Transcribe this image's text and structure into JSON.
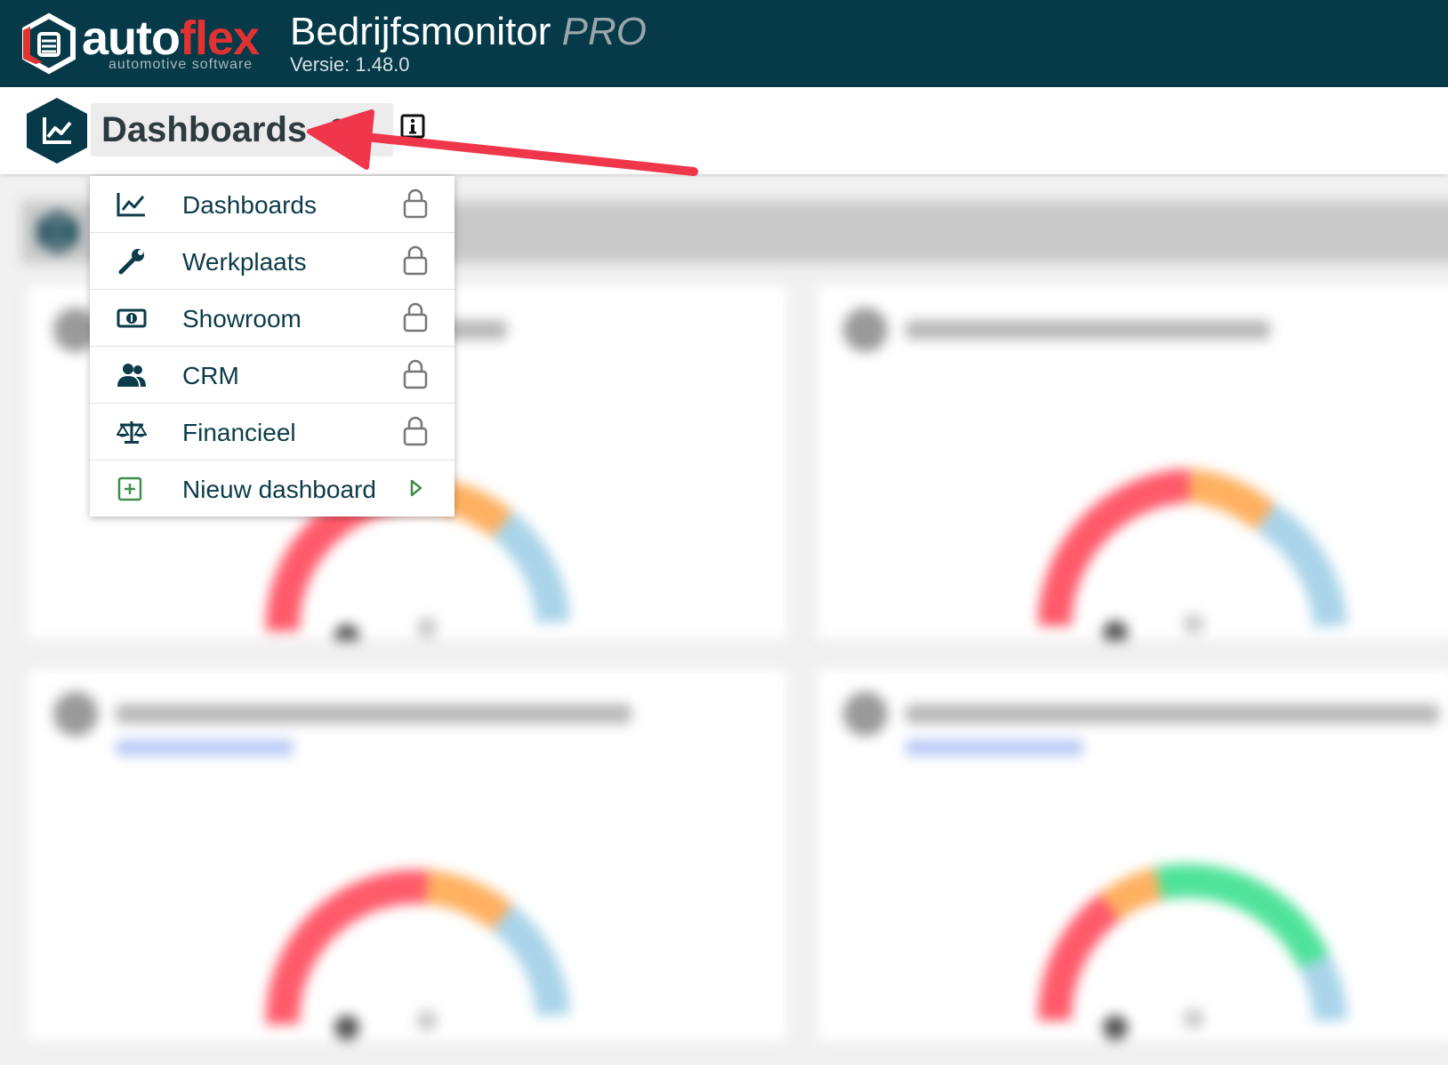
{
  "brand": {
    "logo_word_auto": "auto",
    "logo_word_flex": "flex",
    "logo_subtitle": "automotive software",
    "app_title": "Bedrijfsmonitor",
    "app_title_suffix": "PRO",
    "version": "Versie: 1.48.0"
  },
  "header": {
    "selected_dashboard": "Dashboards",
    "badge_icon": "chart-line-icon",
    "caret_icon": "caret-down-icon",
    "info_icon": "info-icon"
  },
  "menu": {
    "items": [
      {
        "label": "Dashboards",
        "icon": "chart-line-icon",
        "right_icon": "lock-icon"
      },
      {
        "label": "Werkplaats",
        "icon": "wrench-icon",
        "right_icon": "lock-icon"
      },
      {
        "label": "Showroom",
        "icon": "money-bill-icon",
        "right_icon": "lock-icon"
      },
      {
        "label": "CRM",
        "icon": "users-icon",
        "right_icon": "lock-icon"
      },
      {
        "label": "Financieel",
        "icon": "balance-scale-icon",
        "right_icon": "lock-icon"
      },
      {
        "label": "Nieuw dashboard",
        "icon": "plus-square-icon",
        "right_icon": "chevron-right-icon"
      }
    ]
  },
  "colors": {
    "topbar": "#063a49",
    "accent_red": "#e13232",
    "annotation_arrow": "#f0364a",
    "gauge_red": "#ff5a6a",
    "gauge_orange": "#ffb060",
    "gauge_green": "#4fe39a",
    "gauge_blue": "#a9d4ea"
  }
}
